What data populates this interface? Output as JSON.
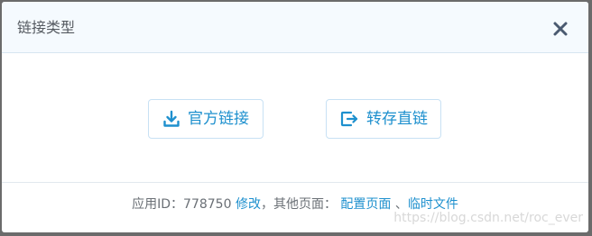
{
  "dialog": {
    "title": "链接类型",
    "close_icon": "close-icon"
  },
  "buttons": {
    "official": {
      "label": "官方链接",
      "icon": "download-icon"
    },
    "transfer": {
      "label": "转存直链",
      "icon": "export-icon"
    }
  },
  "footer": {
    "app_id_label": "应用ID：",
    "app_id_value": "778750",
    "modify_link": "修改",
    "other_pages_label": "，其他页面：",
    "config_page_link": "配置页面",
    "separator": "、",
    "temp_files_link": "临时文件"
  },
  "watermark": "https://blog.csdn.net/roc_ever",
  "colors": {
    "accent": "#1e90ce",
    "header_bg": "#f5fafe",
    "text": "#555a60"
  }
}
